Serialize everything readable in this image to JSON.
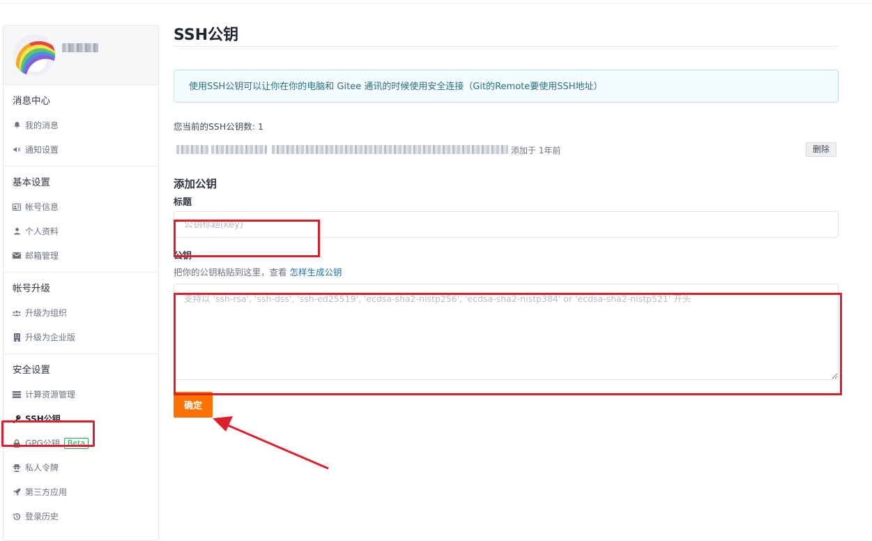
{
  "sidebar": {
    "sections": [
      {
        "title": "消息中心",
        "items": [
          {
            "label": "我的消息",
            "icon": "bell-icon"
          },
          {
            "label": "通知设置",
            "icon": "volume-icon"
          }
        ]
      },
      {
        "title": "基本设置",
        "items": [
          {
            "label": "帐号信息",
            "icon": "id-card-icon"
          },
          {
            "label": "个人资料",
            "icon": "user-icon"
          },
          {
            "label": "邮箱管理",
            "icon": "envelope-icon"
          }
        ]
      },
      {
        "title": "帐号升级",
        "items": [
          {
            "label": "升级为组织",
            "icon": "users-icon"
          },
          {
            "label": "升级为企业版",
            "icon": "building-icon"
          }
        ]
      },
      {
        "title": "安全设置",
        "items": [
          {
            "label": "计算资源管理",
            "icon": "server-icon"
          },
          {
            "label": "SSH公钥",
            "icon": "key-icon",
            "active": true
          },
          {
            "label": "GPG公钥",
            "icon": "lock-icon",
            "badge": "Beta"
          },
          {
            "label": "私人令牌",
            "icon": "spy-icon"
          },
          {
            "label": "第三方应用",
            "icon": "rocket-icon"
          },
          {
            "label": "登录历史",
            "icon": "history-icon"
          }
        ]
      }
    ]
  },
  "main": {
    "title": "SSH公钥",
    "info": "使用SSH公钥可以让你在你的电脑和 Gitee 通讯的时候使用安全连接（Git的Remote要使用SSH地址）",
    "key_count": "您当前的SSH公钥数: 1",
    "existing_key": {
      "added": "添加于 1年前",
      "delete_label": "删除"
    },
    "add_heading": "添加公钥",
    "title_label": "标题",
    "title_placeholder": "公钥标题(key)",
    "key_label": "公钥",
    "key_hint_prefix": "把你的公钥粘贴到这里，查看",
    "key_hint_link": "怎样生成公钥",
    "key_placeholder": "支持以 'ssh-rsa', 'ssh-dss', 'ssh-ed25519', 'ecdsa-sha2-nistp256', 'ecdsa-sha2-nistp384' or 'ecdsa-sha2-nistp521' 开头",
    "submit_label": "确定"
  },
  "colors": {
    "accent": "#fe7300",
    "annotation_red": "#e01d2a",
    "link": "#1d6fa5",
    "info_text": "#276f86",
    "beta_green": "#2ca55b"
  }
}
